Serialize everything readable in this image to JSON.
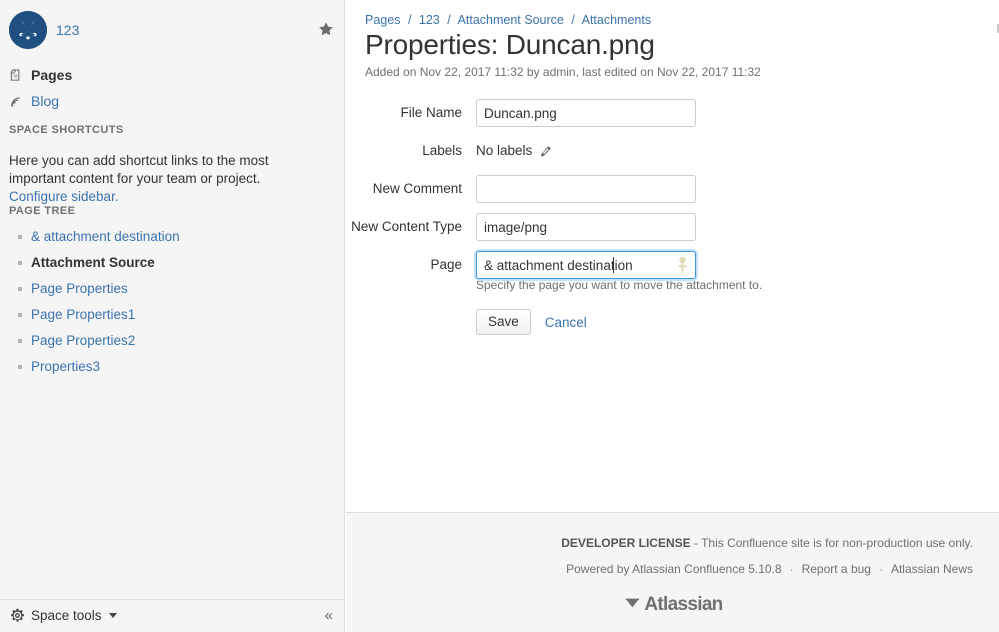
{
  "sidebar": {
    "space": {
      "avatar_icon": "crossed-clubs-logo-icon",
      "avatar_color": "#205081",
      "name": "123",
      "star_icon": "star-icon"
    },
    "nav": [
      {
        "label": "Pages",
        "icon": "pages-document-icon",
        "current": true
      },
      {
        "label": "Blog",
        "icon": "rss-feed-icon",
        "current": false
      }
    ],
    "shortcuts": {
      "heading": "SPACE SHORTCUTS",
      "blurb_text": "Here you can add shortcut links to the most important content for your team or project. ",
      "blurb_link": "Configure sidebar."
    },
    "page_tree": {
      "heading": "PAGE TREE",
      "items": [
        {
          "label": "& attachment destination",
          "current": false
        },
        {
          "label": "Attachment Source",
          "current": true
        },
        {
          "label": "Page Properties",
          "current": false
        },
        {
          "label": "Page Properties1",
          "current": false
        },
        {
          "label": "Page Properties2",
          "current": false
        },
        {
          "label": "Properties3",
          "current": false
        }
      ]
    },
    "footer": {
      "space_tools_label": "Space tools",
      "space_tools_icon": "gear-icon",
      "collapse_icon": "«"
    }
  },
  "main": {
    "breadcrumb": [
      {
        "label": "Pages"
      },
      {
        "label": "123"
      },
      {
        "label": "Attachment Source"
      },
      {
        "label": "Attachments"
      }
    ],
    "breadcrumb_separator": "/",
    "title": "Properties: Duncan.png",
    "meta": "Added on Nov 22, 2017 11:32 by admin, last edited on Nov 22, 2017 11:32",
    "form": {
      "file_name": {
        "label": "File Name",
        "value": "Duncan.png",
        "placeholder": ""
      },
      "labels": {
        "label": "Labels",
        "value": "No labels",
        "edit_icon": "pencil-icon"
      },
      "new_comment": {
        "label": "New Comment",
        "value": "",
        "placeholder": ""
      },
      "new_content_type": {
        "label": "New Content Type",
        "value": "image/png",
        "placeholder": ""
      },
      "page": {
        "label": "Page",
        "value": "& attachment destination",
        "placeholder": "",
        "focused": true,
        "field_icon": "page-picker-icon",
        "hint": "Specify the page you want to move the attachment to.",
        "focus_ring_color": "#3b96e0"
      },
      "save_label": "Save",
      "cancel_label": "Cancel"
    }
  },
  "footer": {
    "license_bold": "DEVELOPER LICENSE",
    "license_rest": " - This Confluence site is for non-production use only.",
    "powered_by": "Powered by Atlassian Confluence 5.10.8",
    "report_bug": "Report a bug",
    "atlassian_news": "Atlassian News",
    "separator": "·",
    "brand": "Atlassian",
    "brand_icon": "atlassian-logo-icon"
  }
}
